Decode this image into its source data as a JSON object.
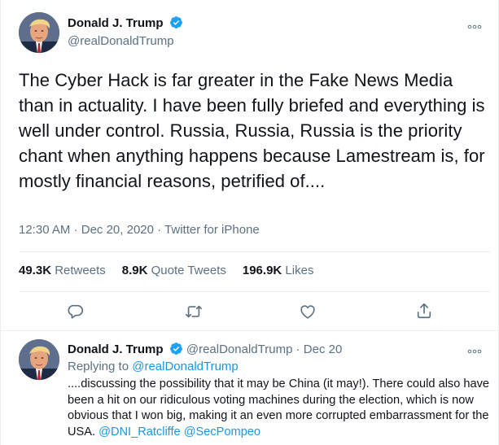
{
  "tweet": {
    "author_name": "Donald J. Trump",
    "author_handle": "@realDonaldTrump",
    "text": "The Cyber Hack is far greater in the Fake News Media than in actuality. I have been fully briefed and everything is well under control. Russia, Russia, Russia is the priority chant when anything happens because Lamestream is, for mostly financial reasons, petrified of....",
    "time": "12:30 AM",
    "separator": "·",
    "date": "Dec 20, 2020",
    "source": "Twitter for iPhone",
    "stats": {
      "retweets_count": "49.3K",
      "retweets_label": "Retweets",
      "quotes_count": "8.9K",
      "quotes_label": "Quote Tweets",
      "likes_count": "196.9K",
      "likes_label": "Likes"
    },
    "actions": [
      "reply-icon",
      "retweet-icon",
      "like-icon",
      "share-icon"
    ],
    "more_icon": "more-icon"
  },
  "reply": {
    "author_name": "Donald J. Trump",
    "author_handle": "@realDonaldTrump",
    "separator": "·",
    "date": "Dec 20",
    "replying_label": "Replying to",
    "replying_to": "@realDonaldTrump",
    "text": "....discussing the possibility that it may be China (it may!). There could also have been a hit on our ridiculous voting machines during the election, which is now obvious that I won big, making it an even more corrupted embarrassment for the USA.",
    "mention_1": "@DNI_Ratcliffe",
    "mention_2": "@SecPompeo",
    "more_icon": "more-icon"
  },
  "colors": {
    "accent": "#1b95e0",
    "verified": "#1da1f2",
    "secondary_text": "#5b7083",
    "divider": "#ebeef0"
  }
}
